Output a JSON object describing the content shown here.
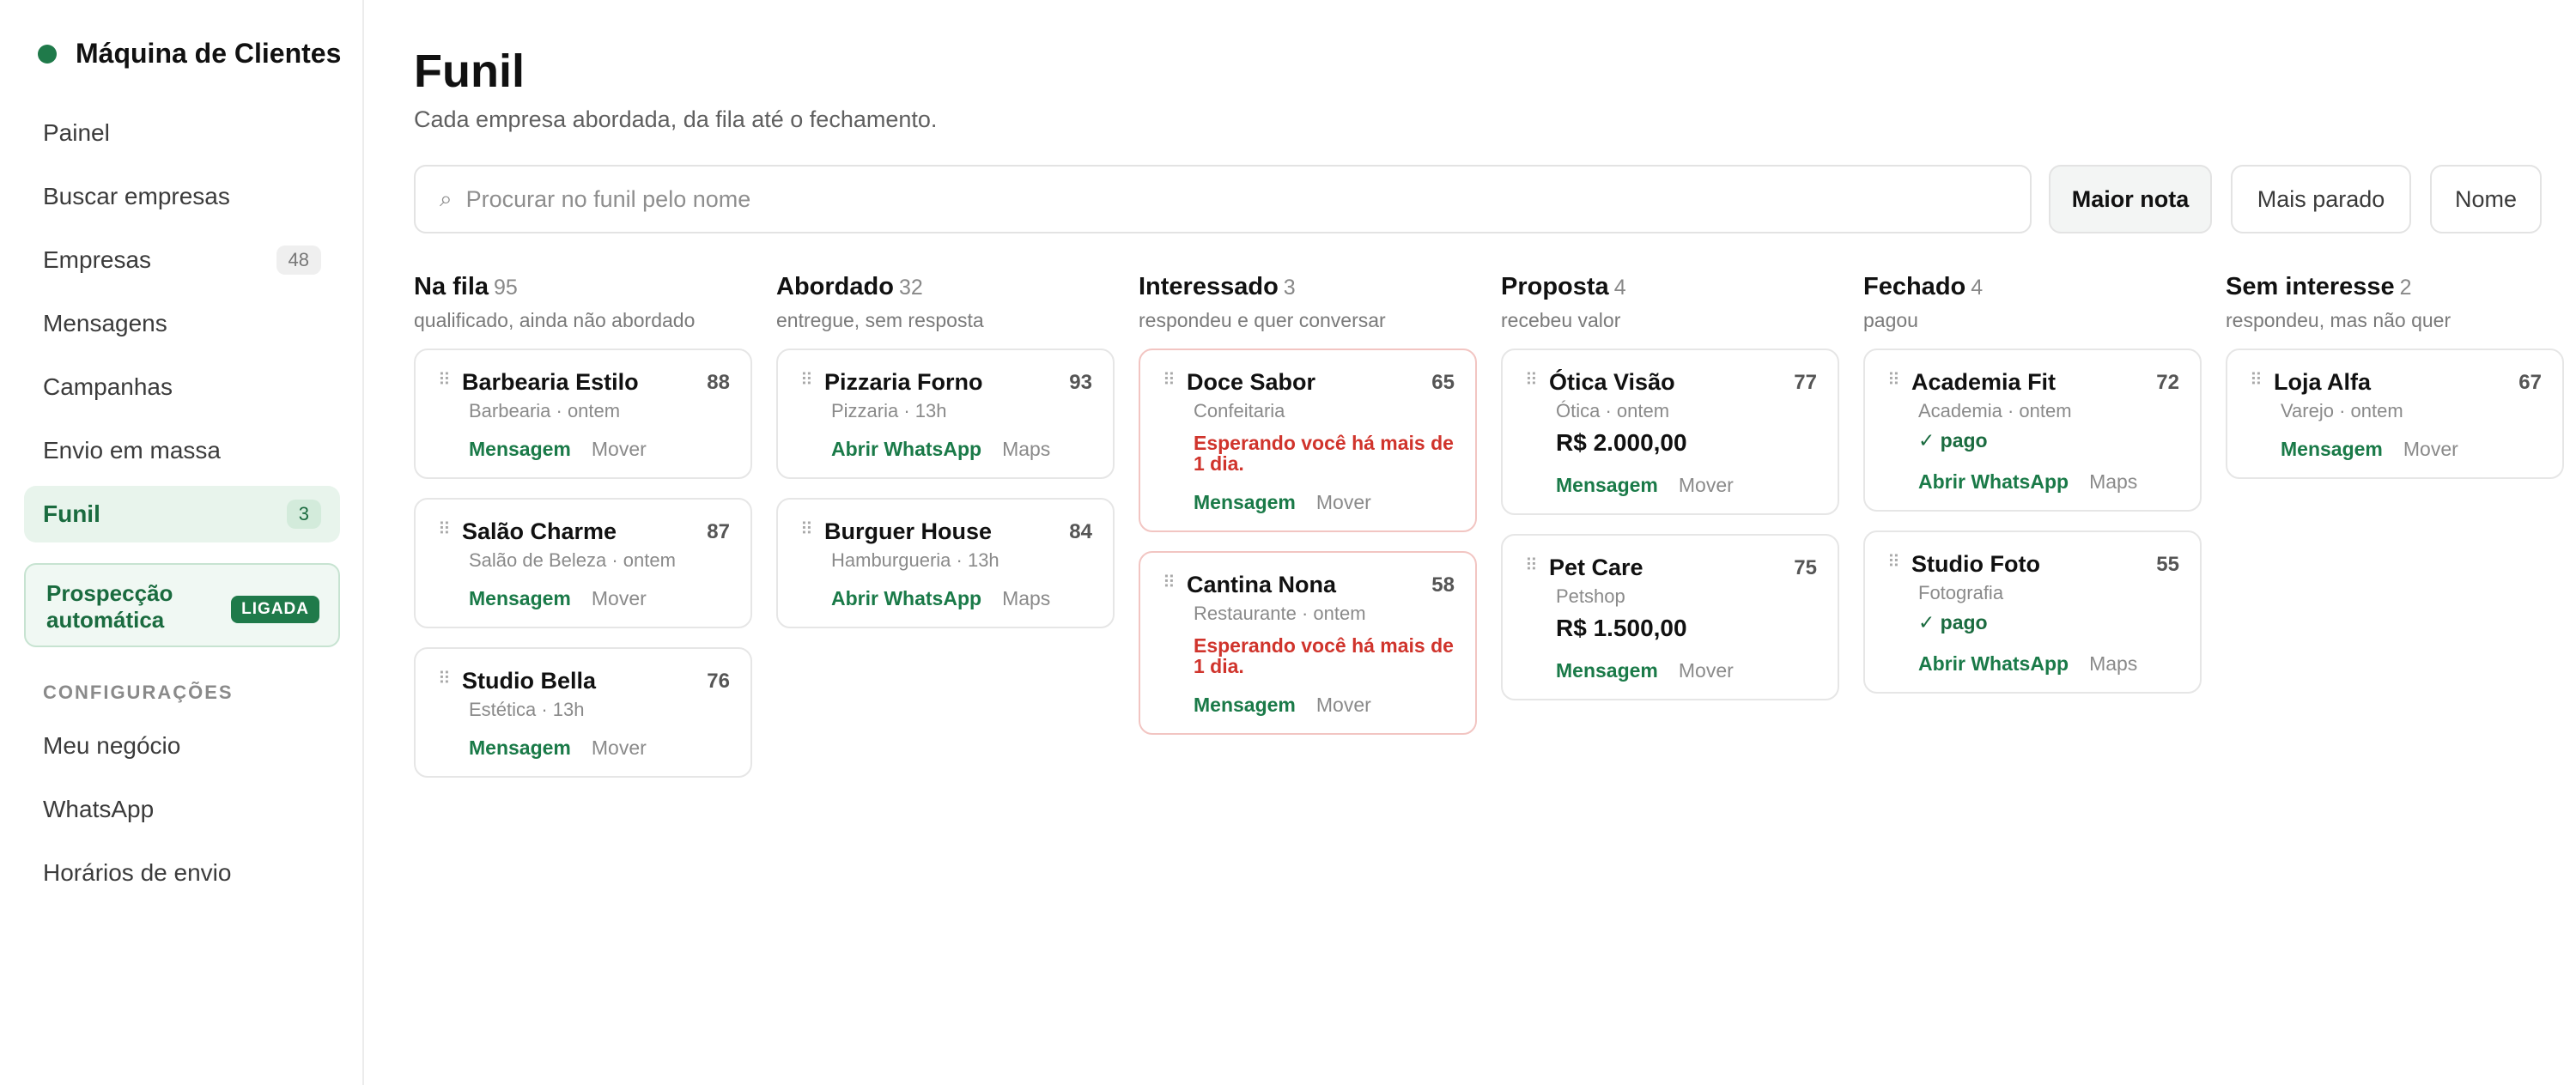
{
  "sidebar": {
    "brand": "Máquina de Clientes",
    "colors": {
      "accent": "#1f7a4a",
      "active_bg": "#e8f4ec",
      "alert": "#d0342c"
    },
    "items": [
      {
        "label": "Painel"
      },
      {
        "label": "Buscar empresas"
      },
      {
        "label": "Empresas",
        "badge": "48"
      },
      {
        "label": "Mensagens"
      },
      {
        "label": "Campanhas"
      },
      {
        "label": "Envio em massa"
      },
      {
        "label": "Funil",
        "badge": "3",
        "active": true
      }
    ],
    "auto_prospect": {
      "label": "Prospecção automática",
      "status": "LIGADA"
    },
    "settings_label": "CONFIGURAÇÕES",
    "settings_items": [
      {
        "label": "Meu negócio"
      },
      {
        "label": "WhatsApp"
      },
      {
        "label": "Horários de envio"
      }
    ]
  },
  "header": {
    "title": "Funil",
    "subtitle": "Cada empresa abordada, da fila até o fechamento."
  },
  "search": {
    "placeholder": "Procurar no funil pelo nome",
    "value": ""
  },
  "sort": {
    "options": [
      "Maior nota",
      "Mais parado",
      "Nome"
    ],
    "selected": "Maior nota"
  },
  "columns": [
    {
      "title": "Na fila",
      "count": "95",
      "desc": "qualificado, ainda não abordado",
      "cards": [
        {
          "name": "Barbearia Estilo",
          "score": "88",
          "meta": "Barbearia · ontem",
          "primary": "Mensagem",
          "secondary": "Mover"
        },
        {
          "name": "Salão Charme",
          "score": "87",
          "meta": "Salão de Beleza · ontem",
          "primary": "Mensagem",
          "secondary": "Mover"
        },
        {
          "name": "Studio Bella",
          "score": "76",
          "meta": "Estética · 13h",
          "primary": "Mensagem",
          "secondary": "Mover"
        }
      ]
    },
    {
      "title": "Abordado",
      "count": "32",
      "desc": "entregue, sem resposta",
      "cards": [
        {
          "name": "Pizzaria Forno",
          "score": "93",
          "meta": "Pizzaria · 13h",
          "primary": "Abrir WhatsApp",
          "secondary": "Maps"
        },
        {
          "name": "Burguer House",
          "score": "84",
          "meta": "Hamburgueria · 13h",
          "primary": "Abrir WhatsApp",
          "secondary": "Maps"
        }
      ]
    },
    {
      "title": "Interessado",
      "count": "3",
      "desc": "respondeu e quer conversar",
      "cards": [
        {
          "name": "Doce Sabor",
          "score": "65",
          "meta": "Confeitaria",
          "warning": "Esperando você há mais de 1 dia.",
          "primary": "Mensagem",
          "secondary": "Mover"
        },
        {
          "name": "Cantina Nona",
          "score": "58",
          "meta": "Restaurante · ontem",
          "warning": "Esperando você há mais de 1 dia.",
          "primary": "Mensagem",
          "secondary": "Mover"
        }
      ]
    },
    {
      "title": "Proposta",
      "count": "4",
      "desc": "recebeu valor",
      "cards": [
        {
          "name": "Ótica Visão",
          "score": "77",
          "meta": "Ótica · ontem",
          "value": "R$ 2.000,00",
          "primary": "Mensagem",
          "secondary": "Mover"
        },
        {
          "name": "Pet Care",
          "score": "75",
          "meta": "Petshop",
          "value": "R$ 1.500,00",
          "primary": "Mensagem",
          "secondary": "Mover"
        }
      ]
    },
    {
      "title": "Fechado",
      "count": "4",
      "desc": "pagou",
      "cards": [
        {
          "name": "Academia Fit",
          "score": "72",
          "meta": "Academia · ontem",
          "paid": "✓ pago",
          "primary": "Abrir WhatsApp",
          "secondary": "Maps"
        },
        {
          "name": "Studio Foto",
          "score": "55",
          "meta": "Fotografia",
          "paid": "✓ pago",
          "primary": "Abrir WhatsApp",
          "secondary": "Maps"
        }
      ]
    },
    {
      "title": "Sem interesse",
      "count": "2",
      "desc": "respondeu, mas não quer",
      "cards": [
        {
          "name": "Loja Alfa",
          "score": "67",
          "meta": "Varejo · ontem",
          "primary": "Mensagem",
          "secondary": "Mover"
        }
      ]
    }
  ]
}
